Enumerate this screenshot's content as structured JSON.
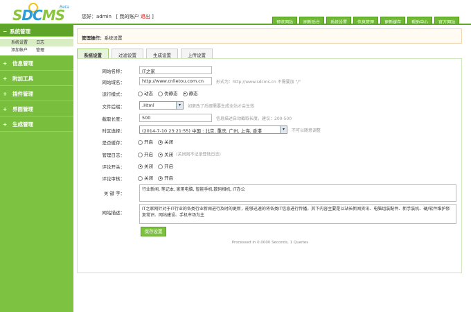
{
  "logo": {
    "s": "S",
    "dc": "DC",
    "ms": "MS",
    "beta": "Beta"
  },
  "userbar": {
    "greeting": "您好：admin",
    "account": "[ 我的账户",
    "logout": "退出",
    "close_bracket": "]"
  },
  "topnav": [
    "预览网站",
    "刷新后台",
    "系统设置",
    "信息管理",
    "更新缓存",
    "帮助中心",
    "官方网站"
  ],
  "sidebar": {
    "system_title": "系统管理",
    "sub_rows": [
      [
        "系统设置",
        "日志"
      ],
      [
        "添加帐户",
        "管理"
      ]
    ],
    "items": [
      "信息管理",
      "附加工具",
      "插件管理",
      "界面管理",
      "生成管理"
    ]
  },
  "crumb": {
    "label": "管理操作：",
    "value": "系统设置"
  },
  "tabs": [
    "系统设置",
    "过滤设置",
    "生成设置",
    "上传设置"
  ],
  "form": {
    "site_name": {
      "label": "网站名称：",
      "value": "IT之家"
    },
    "site_url": {
      "label": "网站域名：",
      "value": "http://www.cnlietou.com.cn",
      "note": "形式为：http://www.sdcms.cn  不需要加 \"/\""
    },
    "run_mode": {
      "label": "运行模式：",
      "options": [
        "动态",
        "伪静态",
        "静态"
      ],
      "selected": 2
    },
    "file_ext": {
      "label": "文件后缀：",
      "value": ".Html",
      "note": "如更改了后缀需要生成全站才会生效"
    },
    "cut_length": {
      "label": "截取长度：",
      "value": "500",
      "note": "信息描述自动截取长度，建议：200-500"
    },
    "timezone": {
      "label": "时区选择：",
      "value": "(2014-7-10 23:21:55) 中国 : 北京, 重庆, 广州, 上海, 香港",
      "note": "不可以随意调整"
    },
    "cache": {
      "label": "是否缓存：",
      "options": [
        "开启",
        "关闭"
      ],
      "selected": 1
    },
    "admin_log": {
      "label": "管理日志：",
      "options": [
        "开启",
        "关闭"
      ],
      "selected": 1,
      "note": "(关闭则不记录登陆日志)"
    },
    "comment_switch": {
      "label": "评论开关：",
      "options": [
        "关闭",
        "开启"
      ],
      "selected": 0
    },
    "comment_audit": {
      "label": "评论审核：",
      "options": [
        "关闭",
        "开启"
      ],
      "selected": 1
    },
    "keywords": {
      "label": "关 键 字：",
      "value": "行业新闻, 笔记本, 家用电脑, 智能手机,数码相机, IT办公"
    },
    "description": {
      "label": "网站描述：",
      "value": "IT之家网针对于IT行业的各类行业新闻进行及时的更新，能够迅速的将各类IT信息进行传播，其下内容主要是以站长新闻资讯、电脑组装配件、新手装机、硬/软件维护修复常识、网站建设、手机市场为主"
    },
    "save_label": "保存设置"
  },
  "footer": "Processed in 0.0000 Seconds, 1 Queries",
  "colors": {
    "accent": "#7dc241",
    "dark_green": "#5fa52a",
    "blue": "#2f9bd7"
  }
}
